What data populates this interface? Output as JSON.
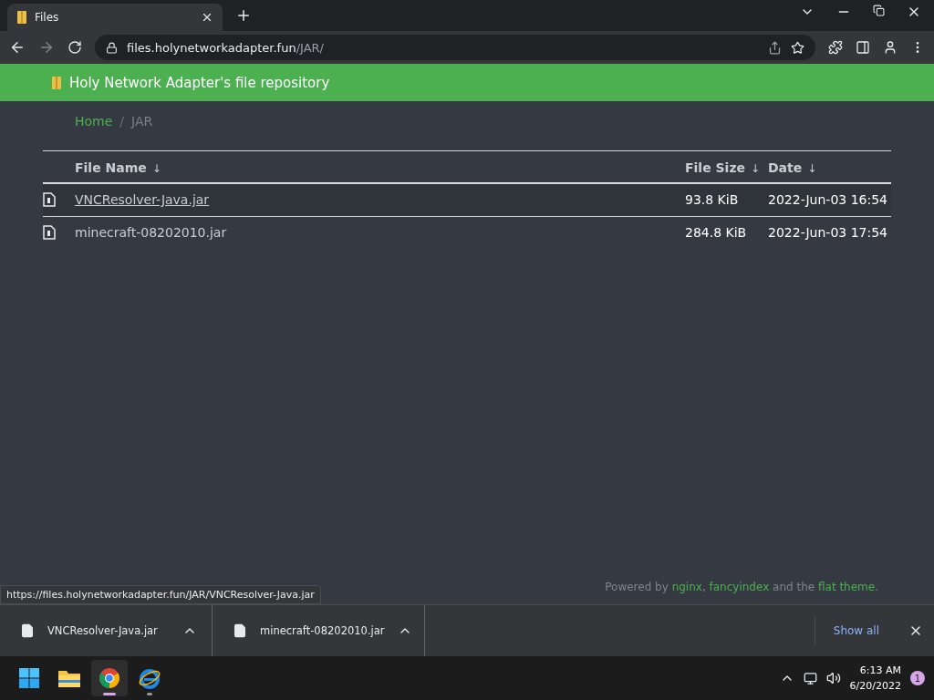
{
  "browser": {
    "tab": {
      "title": "Files"
    },
    "address": {
      "host": "files.holynetworkadapter.fun",
      "path": "/JAR/"
    }
  },
  "header": {
    "title": "Holy Network Adapter's file repository"
  },
  "breadcrumb": [
    {
      "label": "Home",
      "selected": false
    },
    {
      "label": "JAR",
      "selected": true
    }
  ],
  "breadcrumb_separator": "/",
  "table": {
    "columns": [
      {
        "label": "File Name",
        "sort_arrow": "↓"
      },
      {
        "label": "File Size",
        "sort_arrow": "↓"
      },
      {
        "label": "Date",
        "sort_arrow": "↓"
      }
    ],
    "rows": [
      {
        "name": "VNCResolver-Java.jar",
        "size": "93.8 KiB",
        "date": "2022-Jun-03 16:54",
        "hovered": true
      },
      {
        "name": "minecraft-08202010.jar",
        "size": "284.8 KiB",
        "date": "2022-Jun-03 17:54",
        "hovered": false
      }
    ]
  },
  "footer": "Powered by **nginx**, **fancyindex** and the **flat theme**.",
  "status_url": "https://files.holynetworkadapter.fun/JAR/VNCResolver-Java.jar",
  "downloads": [
    {
      "name": "VNCResolver-Java.jar"
    },
    {
      "name": "minecraft-08202010.jar"
    }
  ],
  "show_all": "Show all",
  "taskbar": {
    "apps": [
      {
        "kind": "start",
        "selected": false
      },
      {
        "kind": "folder",
        "selected": false
      },
      {
        "kind": "chrome",
        "selected": true
      },
      {
        "kind": "ie",
        "selected": false
      }
    ],
    "time": "6:13 AM",
    "date": "6/20/2022",
    "notifications": "1"
  }
}
